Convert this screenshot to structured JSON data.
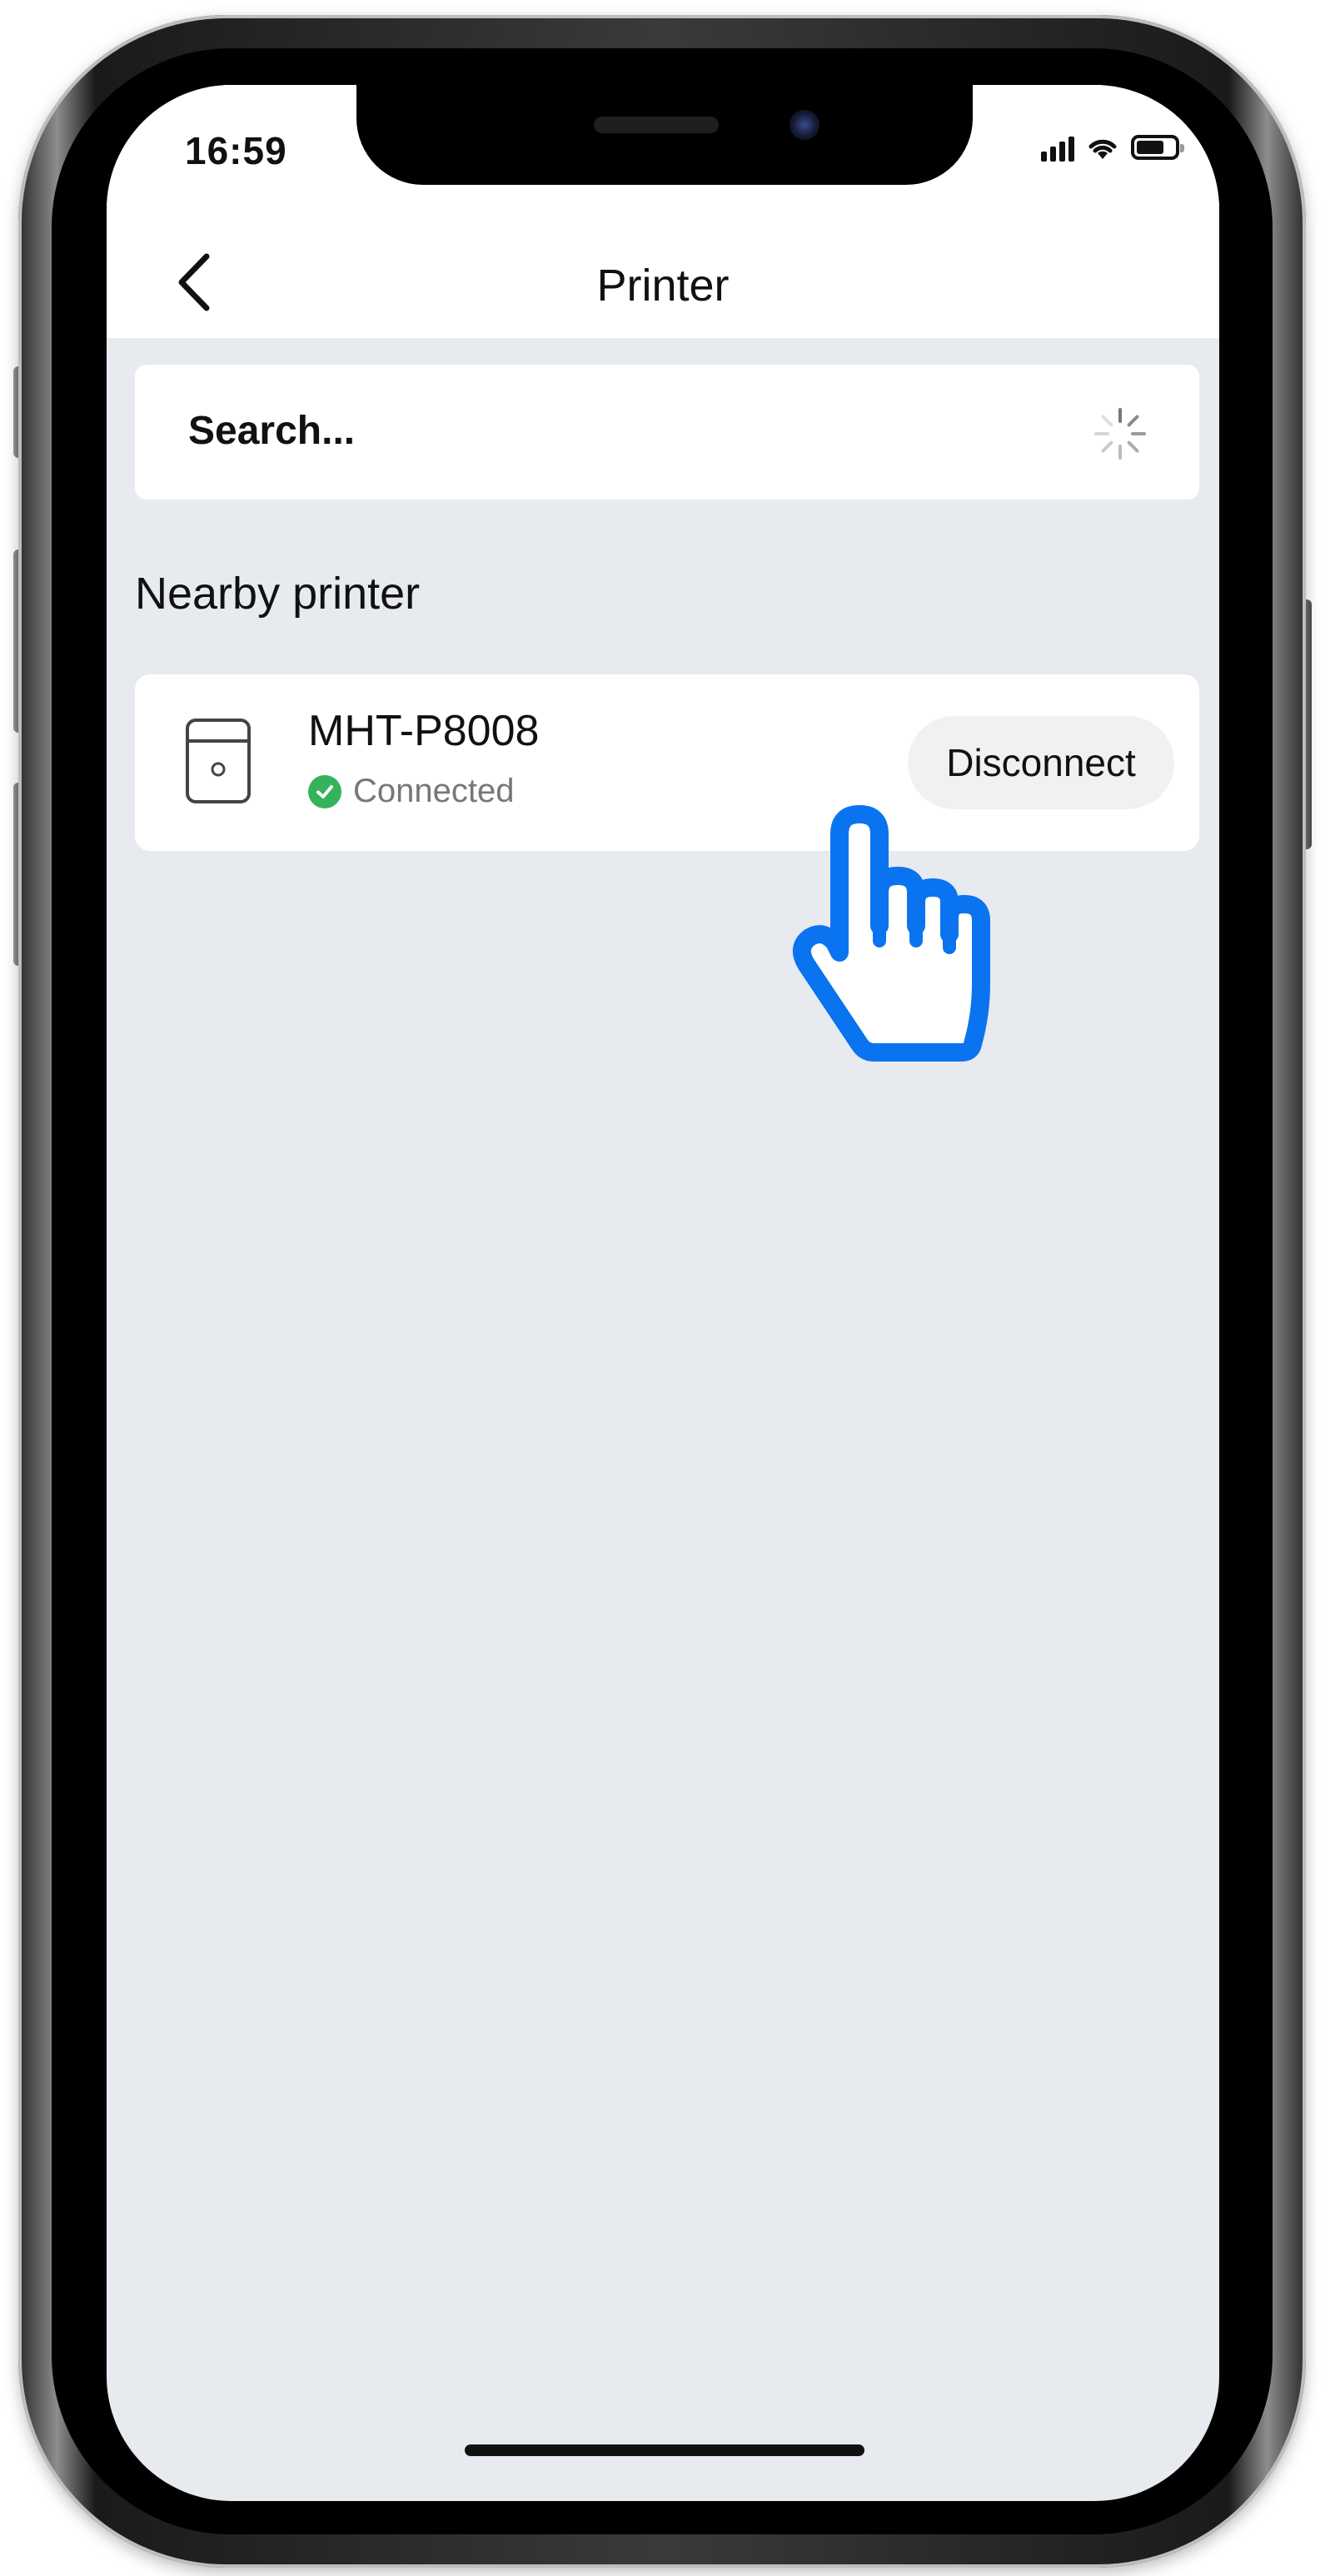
{
  "status_bar": {
    "time": "16:59"
  },
  "nav": {
    "title": "Printer",
    "back_icon": "chevron-left-icon"
  },
  "search": {
    "text": "Search...",
    "loading_icon": "spinner-icon"
  },
  "nearby": {
    "section_title": "Nearby printer",
    "printers": [
      {
        "name": "MHT-P8008",
        "status": "Connected",
        "status_color": "#34b35a",
        "action_label": "Disconnect"
      }
    ]
  },
  "overlay": {
    "cursor_icon": "pointing-hand-icon",
    "cursor_color": "#0a74f0"
  }
}
